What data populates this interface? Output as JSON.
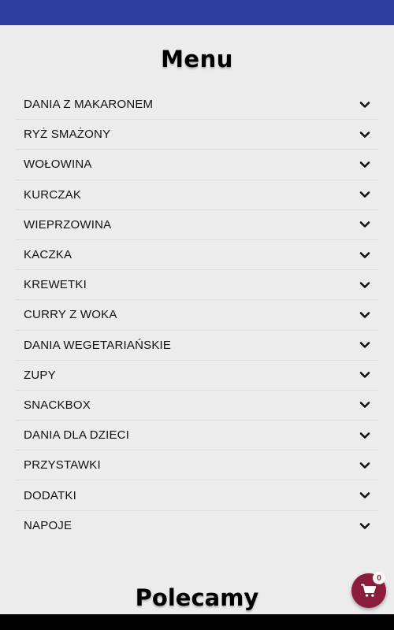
{
  "header": {
    "bar_color": "#2e3d9e"
  },
  "menu": {
    "title": "Menu",
    "items": [
      {
        "label": "DANIA Z MAKARONEM"
      },
      {
        "label": "RYŻ SMAŻONY"
      },
      {
        "label": "WOŁOWINA"
      },
      {
        "label": "KURCZAK"
      },
      {
        "label": "WIEPRZOWINA"
      },
      {
        "label": "KACZKA"
      },
      {
        "label": "KREWETKI"
      },
      {
        "label": "CURRY Z WOKA"
      },
      {
        "label": "DANIA WEGETARIAŃSKIE"
      },
      {
        "label": "ZUPY"
      },
      {
        "label": "SNACKBOX"
      },
      {
        "label": "DANIA DLA DZIECI"
      },
      {
        "label": "PRZYSTAWKI"
      },
      {
        "label": "DODATKI"
      },
      {
        "label": "NAPOJE"
      }
    ],
    "expand_icon": "chevron-down-icon"
  },
  "recommended": {
    "title": "Polecamy"
  },
  "cart": {
    "count": "0",
    "icon": "cart-icon",
    "color": "#8a1c3c"
  }
}
